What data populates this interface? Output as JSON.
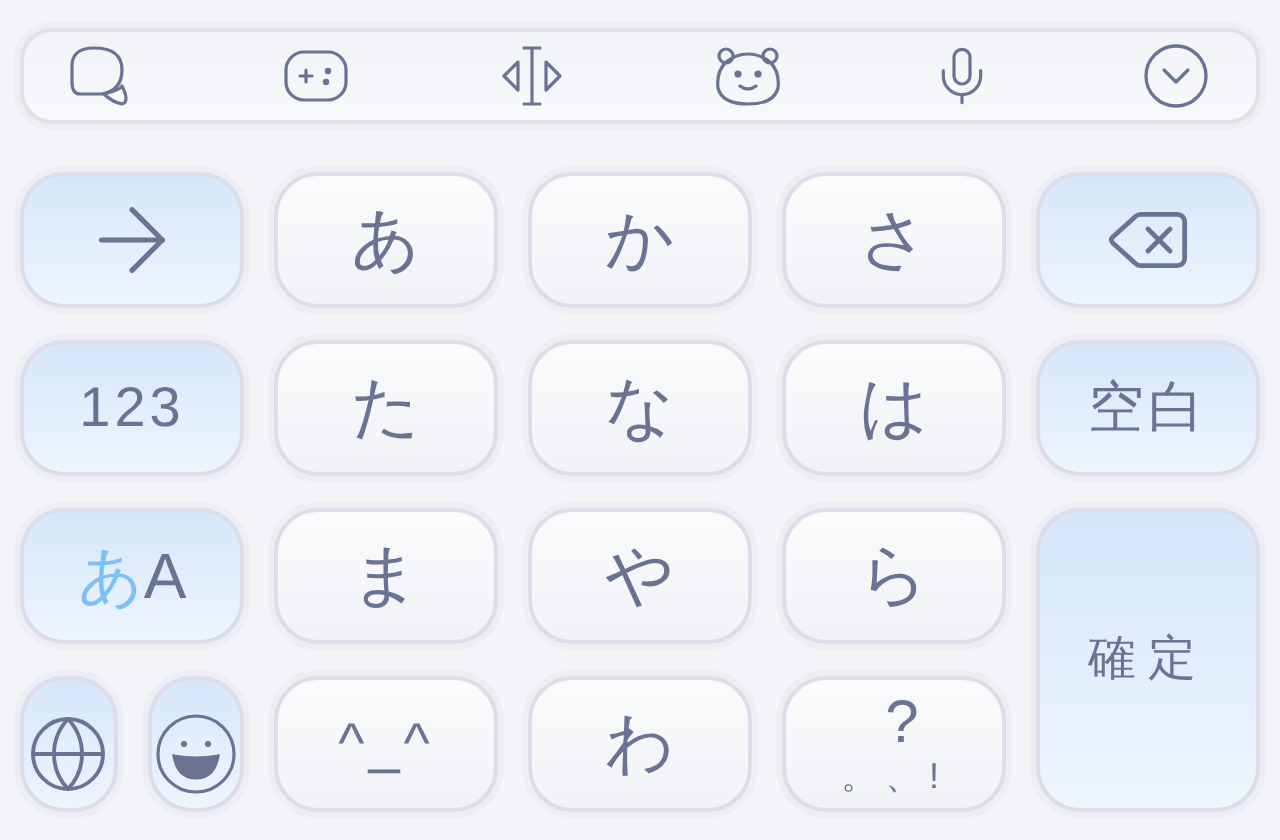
{
  "keys": [
    {
      "kind": "next",
      "accent": true
    },
    {
      "kind": "text",
      "accent": false,
      "label": "あ"
    },
    {
      "kind": "text",
      "accent": false,
      "label": "か"
    },
    {
      "kind": "text",
      "accent": false,
      "label": "さ"
    },
    {
      "kind": "delete",
      "accent": true
    },
    {
      "kind": "text",
      "accent": true,
      "label": "123"
    },
    {
      "kind": "text",
      "accent": false,
      "label": "た"
    },
    {
      "kind": "text",
      "accent": false,
      "label": "な"
    },
    {
      "kind": "text",
      "accent": false,
      "label": "は"
    },
    {
      "kind": "text",
      "accent": true,
      "label": "空白"
    },
    {
      "kind": "mode",
      "accent": true,
      "labels": [
        {
          "text": "あ",
          "selected": true
        },
        {
          "text": "A",
          "selected": false
        }
      ]
    },
    {
      "kind": "text",
      "accent": false,
      "label": "ま"
    },
    {
      "kind": "text",
      "accent": false,
      "label": "や"
    },
    {
      "kind": "text",
      "accent": false,
      "label": "ら"
    },
    {
      "kind": "confirm",
      "accent": true,
      "label": "確定"
    },
    {
      "kind": "globe",
      "accent": true
    },
    {
      "kind": "emoji",
      "accent": true
    },
    {
      "kind": "text",
      "accent": false,
      "label": "^_^"
    },
    {
      "kind": "text",
      "accent": false,
      "label": "わ"
    },
    {
      "kind": "symbols",
      "accent": false,
      "label": "?",
      "sublabel": "。、!"
    }
  ]
}
